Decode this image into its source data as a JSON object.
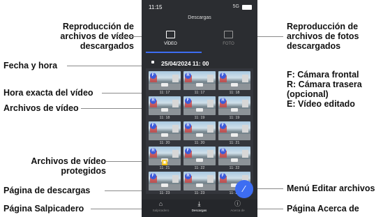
{
  "callouts": {
    "video_tab": "Reproducción de\narchivos de vídeo\ndescargados",
    "photo_tab": "Reproducción de\narchivos de fotos\ndescargados",
    "date_time": "Fecha y hora",
    "exact_time": "Hora exacta del vídeo",
    "video_files": "Archivos de vídeo",
    "legend": "F: Cámara frontal\nR: Cámara trasera\n(opcional)\nE: Vídeo editado",
    "protected": "Archivos de vídeo\nprotegidos",
    "downloads_page": "Página de descargas",
    "edit_menu": "Menú Editar archivos",
    "dashboard_page": "Página Salpicadero",
    "about_page": "Página Acerca de"
  },
  "phone": {
    "status_time": "11:15",
    "status_signal": "5G",
    "title": "Descargas",
    "tabs": [
      {
        "label": "VÍDEO",
        "icon": "video-icon",
        "active": true
      },
      {
        "label": "FOTO",
        "icon": "photo-icon",
        "active": false
      }
    ],
    "date_header": "25/04/2024 11: 00",
    "thumbs": [
      {
        "cam": "F",
        "time": "11: 17",
        "locked": false
      },
      {
        "cam": "R",
        "time": "11: 17",
        "locked": false
      },
      {
        "cam": "F",
        "time": "11: 18",
        "locked": false
      },
      {
        "cam": "R",
        "time": "11: 18",
        "locked": false
      },
      {
        "cam": "F",
        "time": "11: 19",
        "locked": false
      },
      {
        "cam": "R",
        "time": "11: 19",
        "locked": false
      },
      {
        "cam": "F",
        "time": "11: 20",
        "locked": false
      },
      {
        "cam": "R",
        "time": "11: 20",
        "locked": false
      },
      {
        "cam": "F",
        "time": "11: 21",
        "locked": false
      },
      {
        "cam": "R",
        "time": "11: 21",
        "locked": true
      },
      {
        "cam": "F",
        "time": "11: 22",
        "locked": false
      },
      {
        "cam": "R",
        "time": "11: 22",
        "locked": false
      },
      {
        "cam": "F",
        "time": "11: 23",
        "locked": false
      },
      {
        "cam": "R",
        "time": "11: 23",
        "locked": false
      },
      {
        "cam": "F",
        "time": "11: 24",
        "locked": false
      }
    ],
    "fab_icon": "edit-icon",
    "nav": [
      {
        "label": "Salpicadero",
        "icon": "home-icon",
        "active": false
      },
      {
        "label": "Descargas",
        "icon": "download-icon",
        "active": true
      },
      {
        "label": "Acerca de",
        "icon": "info-icon",
        "active": false
      }
    ]
  },
  "colors": {
    "phone_bg": "#2b2d31",
    "accent": "#3d6df2",
    "lock": "#f3c318"
  }
}
